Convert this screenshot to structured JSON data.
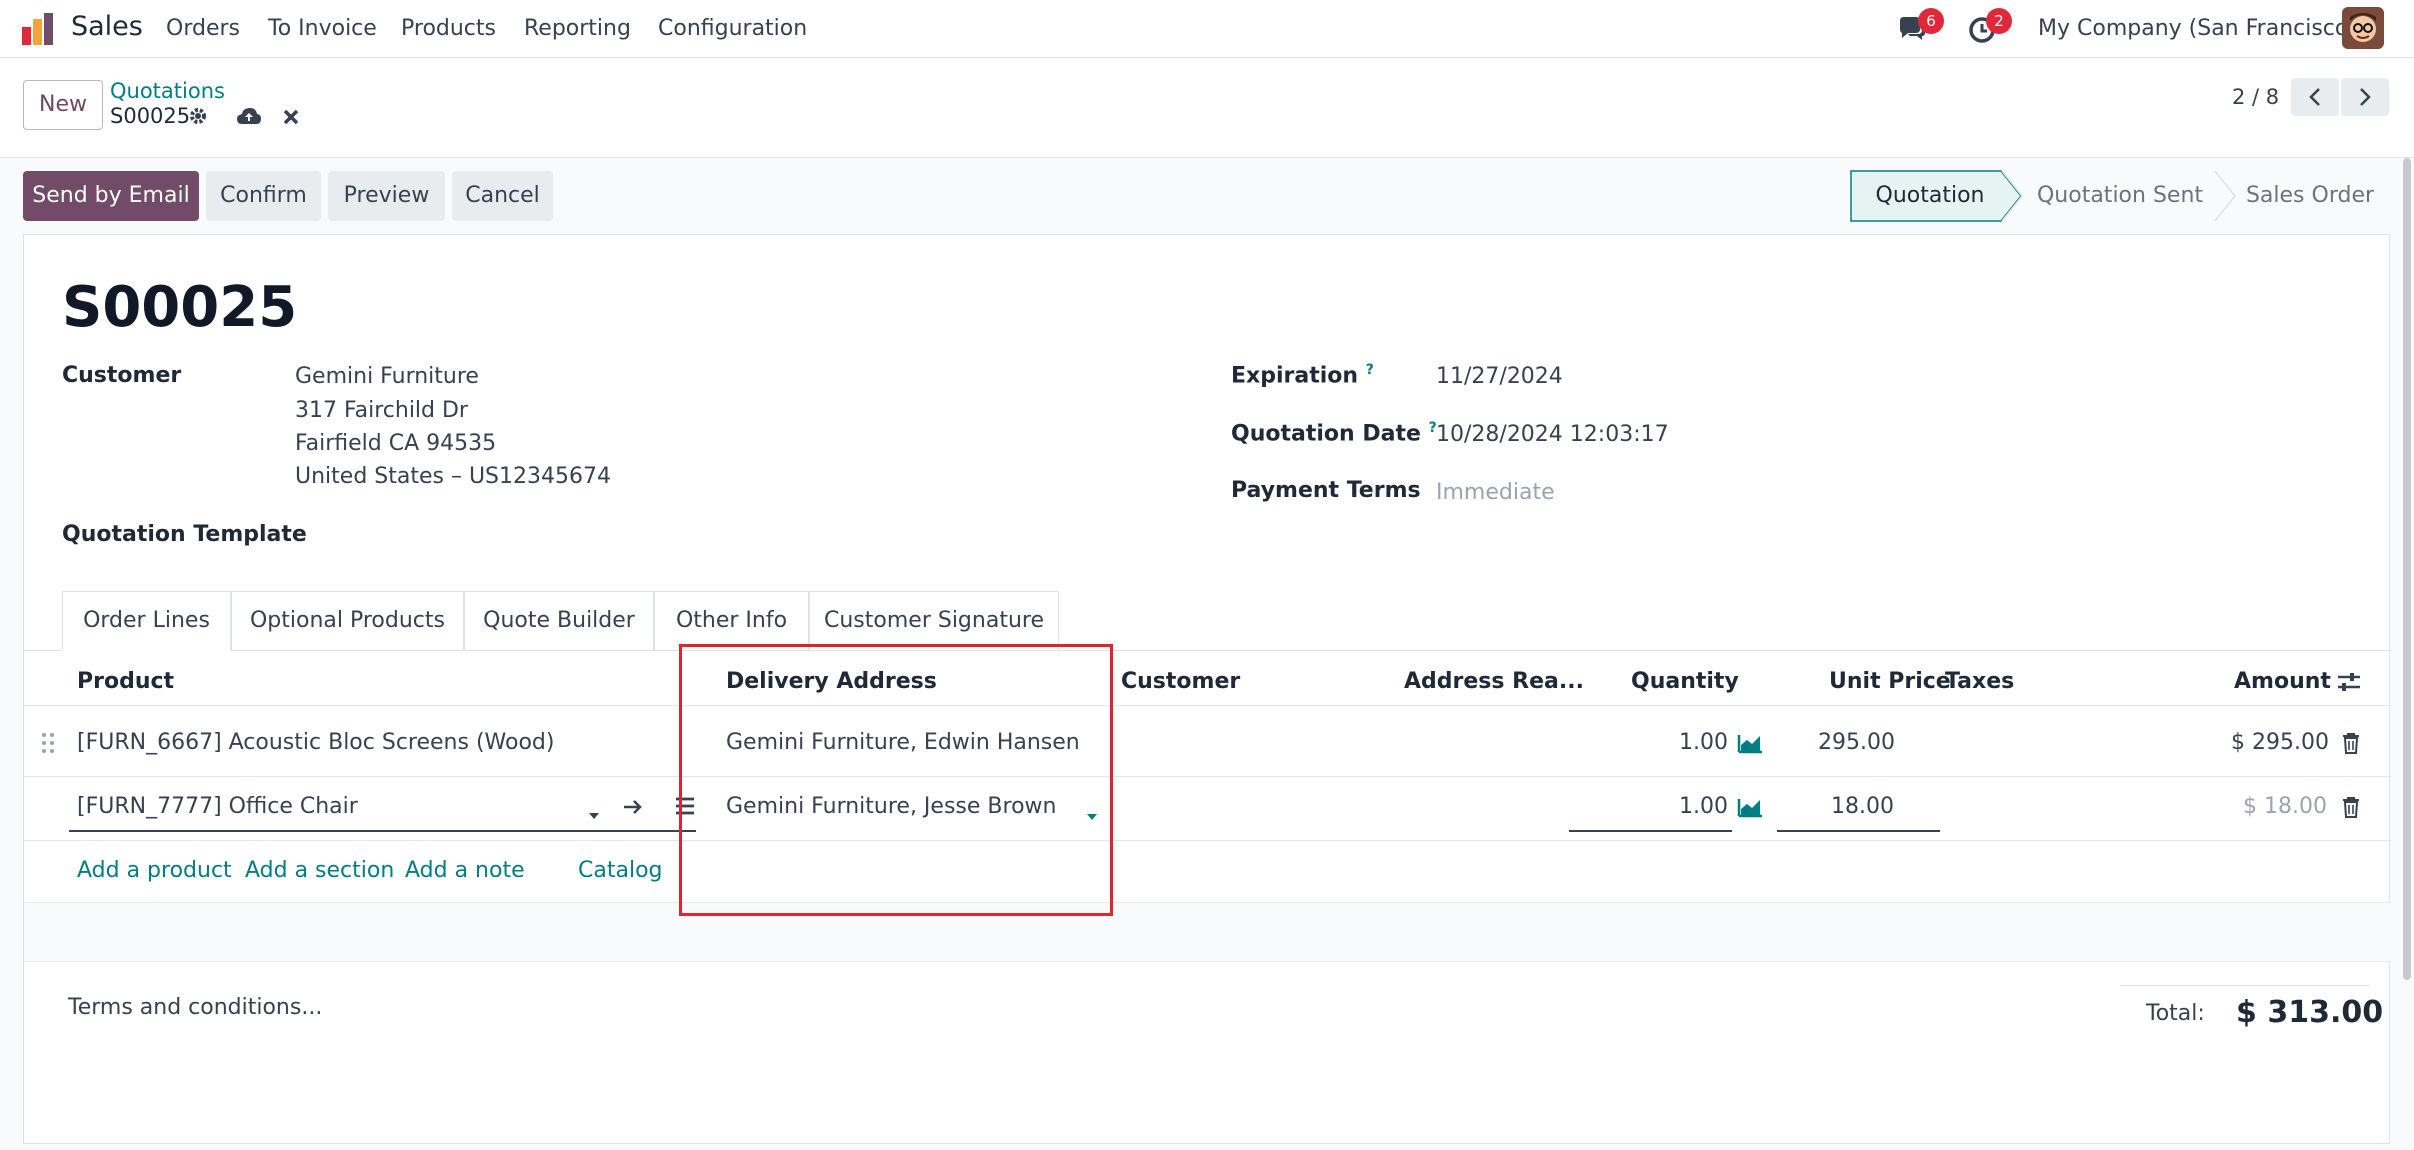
{
  "nav": {
    "app_name": "Sales",
    "menu": [
      "Orders",
      "To Invoice",
      "Products",
      "Reporting",
      "Configuration"
    ],
    "messages_count": "6",
    "activities_count": "2",
    "company": "My Company (San Francisco)"
  },
  "control": {
    "new_label": "New",
    "breadcrumb": "Quotations",
    "record": "S00025",
    "pager": "2 / 8"
  },
  "actions": {
    "send_email": "Send by Email",
    "confirm": "Confirm",
    "preview": "Preview",
    "cancel": "Cancel"
  },
  "status": {
    "stages": [
      "Quotation",
      "Quotation Sent",
      "Sales Order"
    ],
    "active": "Quotation"
  },
  "form": {
    "title": "S00025",
    "customer_label": "Customer",
    "customer_name": "Gemini Furniture",
    "address_line1": "317 Fairchild Dr",
    "address_line2": "Fairfield CA 94535",
    "address_line3": "United States – US12345674",
    "template_label": "Quotation Template",
    "expiration_label": "Expiration",
    "expiration_value": "11/27/2024",
    "date_label": "Quotation Date",
    "date_value": "10/28/2024 12:03:17",
    "terms_label": "Payment Terms",
    "terms_placeholder": "Immediate",
    "help_mark": "?"
  },
  "tabs": [
    "Order Lines",
    "Optional Products",
    "Quote Builder",
    "Other Info",
    "Customer Signature"
  ],
  "table": {
    "headers": {
      "product": "Product",
      "delivery": "Delivery Address",
      "customer": "Customer",
      "address_ready": "Address Rea...",
      "quantity": "Quantity",
      "unit_price": "Unit Price",
      "taxes": "Taxes",
      "amount": "Amount"
    },
    "rows": [
      {
        "product": "[FURN_6667] Acoustic Bloc Screens (Wood)",
        "delivery": "Gemini Furniture, Edwin Hansen",
        "quantity": "1.00",
        "unit_price": "295.00",
        "amount": "$ 295.00"
      },
      {
        "product": "[FURN_7777] Office Chair",
        "delivery": "Gemini Furniture, Jesse Brown",
        "quantity": "1.00",
        "unit_price": "18.00",
        "amount": "$ 18.00"
      }
    ],
    "add_product": "Add a product",
    "add_section": "Add a section",
    "add_note": "Add a note",
    "catalog": "Catalog"
  },
  "footer": {
    "terms_placeholder": "Terms and conditions...",
    "total_label": "Total:",
    "total_value": "$ 313.00"
  },
  "colors": {
    "brand": "#714b67",
    "link": "#017e84",
    "highlight": "#e0232e",
    "badge": "#e0283a"
  }
}
